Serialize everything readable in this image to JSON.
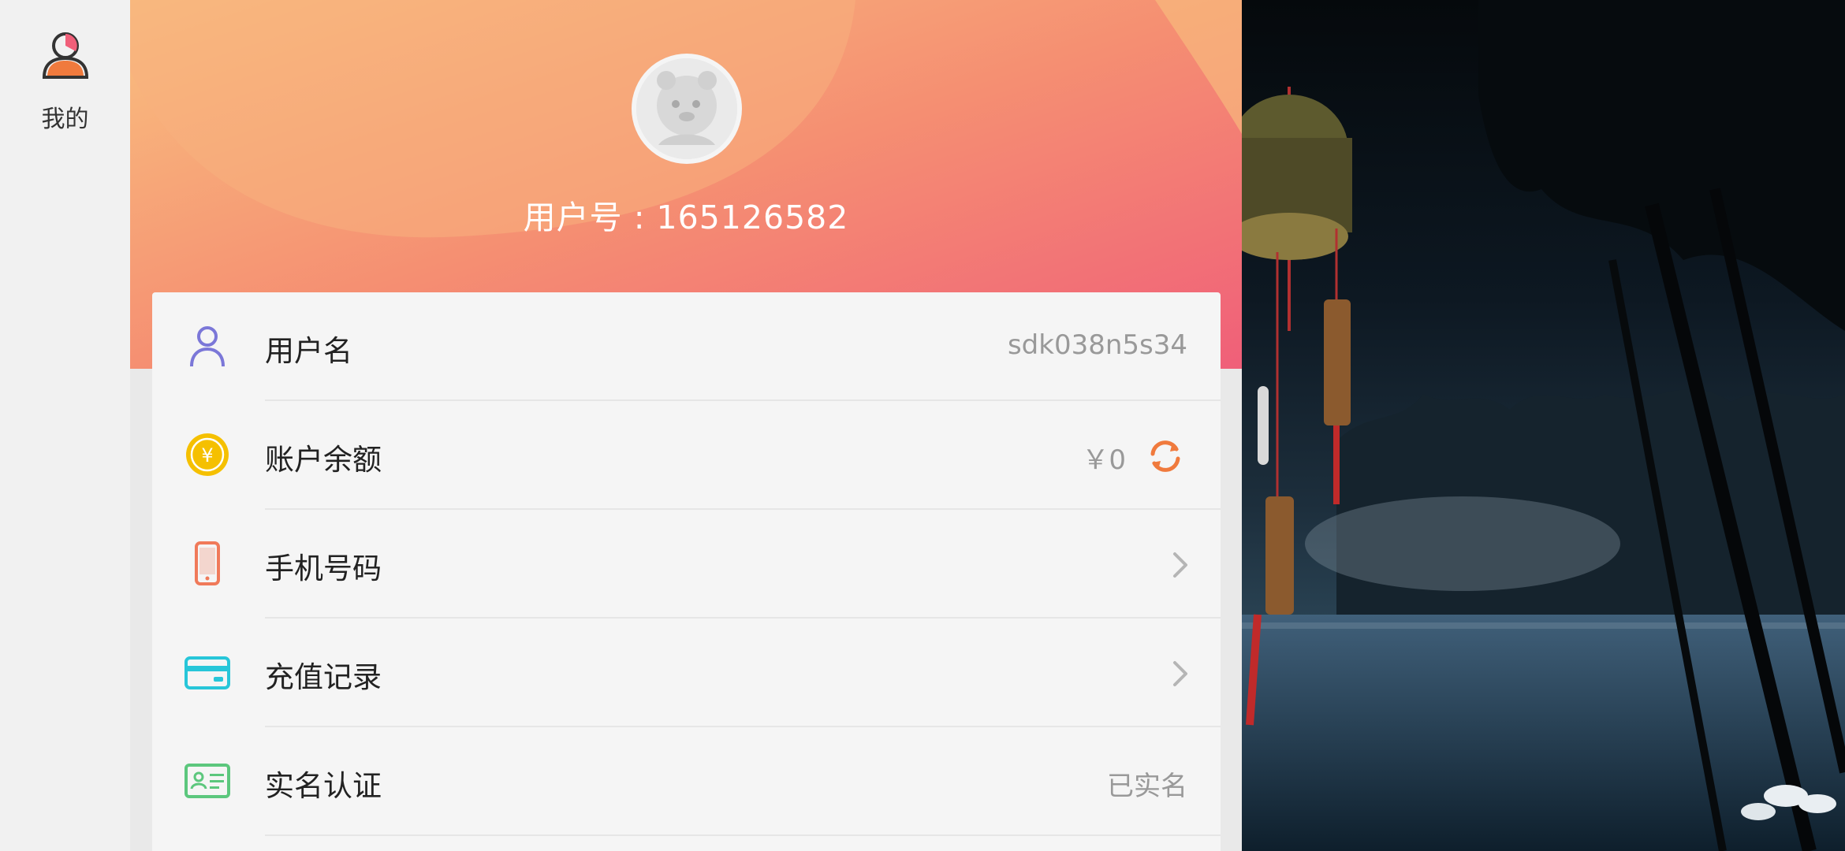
{
  "nav": {
    "tab_me_label": "我的"
  },
  "header": {
    "user_number": "用户号 : 165126582"
  },
  "rows": [
    {
      "label": "用户名",
      "value": "sdk038n5s34",
      "icon": "person-icon"
    },
    {
      "label": "账户余额",
      "value": "￥0",
      "icon": "coin-icon",
      "action": "refresh-icon"
    },
    {
      "label": "手机号码",
      "icon": "phone-icon",
      "action": "chevron-right-icon"
    },
    {
      "label": "充值记录",
      "icon": "card-icon",
      "action": "chevron-right-icon"
    },
    {
      "label": "实名认证",
      "value": "已实名",
      "icon": "id-card-icon"
    }
  ],
  "colors": {
    "header_gradient_start": "#f7b37a",
    "header_gradient_end": "#f05f79",
    "accent_orange": "#f07a3d",
    "coin_yellow": "#f5c000",
    "card_cyan": "#27c6d9",
    "idcard_green": "#5cc77d",
    "person_purple": "#7b77d8"
  }
}
